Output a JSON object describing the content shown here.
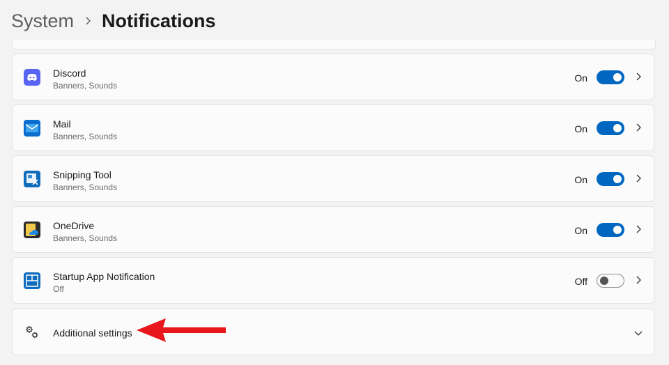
{
  "breadcrumb": {
    "parent": "System",
    "current": "Notifications"
  },
  "apps": [
    {
      "name": "Discord",
      "subtitle": "Banners, Sounds",
      "state_label": "On",
      "enabled": true,
      "icon": "discord-icon"
    },
    {
      "name": "Mail",
      "subtitle": "Banners, Sounds",
      "state_label": "On",
      "enabled": true,
      "icon": "mail-icon"
    },
    {
      "name": "Snipping Tool",
      "subtitle": "Banners, Sounds",
      "state_label": "On",
      "enabled": true,
      "icon": "snipping-tool-icon"
    },
    {
      "name": "OneDrive",
      "subtitle": "Banners, Sounds",
      "state_label": "On",
      "enabled": true,
      "icon": "onedrive-icon"
    },
    {
      "name": "Startup App Notification",
      "subtitle": "Off",
      "state_label": "Off",
      "enabled": false,
      "icon": "startup-app-icon"
    }
  ],
  "additional_settings": {
    "label": "Additional settings",
    "icon": "gears-icon",
    "expanded": false
  },
  "colors": {
    "accent": "#0067c0",
    "annotation_arrow": "#e8171b"
  }
}
